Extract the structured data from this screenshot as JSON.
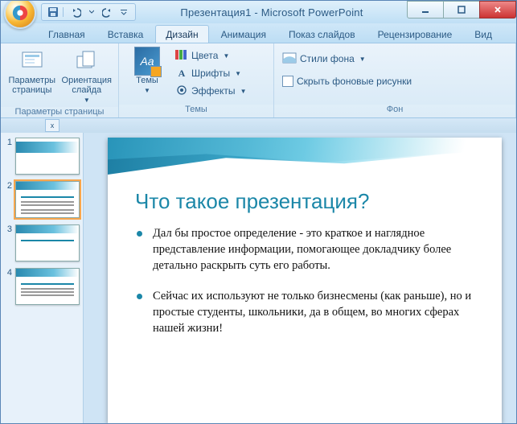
{
  "window": {
    "title": "Презентация1 - Microsoft PowerPoint"
  },
  "tabs": {
    "home": "Главная",
    "insert": "Вставка",
    "design": "Дизайн",
    "animations": "Анимация",
    "slideshow": "Показ слайдов",
    "review": "Рецензирование",
    "view": "Вид"
  },
  "ribbon": {
    "page_setup_group": "Параметры страницы",
    "page_setup_btn": "Параметры страницы",
    "orientation_btn": "Ориентация слайда",
    "themes_group": "Темы",
    "themes_btn": "Темы",
    "themes_glyph": "Aa",
    "colors": "Цвета",
    "fonts": "Шрифты",
    "effects": "Эффекты",
    "background_group": "Фон",
    "bg_styles": "Стили фона",
    "hide_bg": "Скрыть фоновые рисунки"
  },
  "thumbs": {
    "n1": "1",
    "n2": "2",
    "n3": "3",
    "n4": "4"
  },
  "slide": {
    "title": "Что такое презентация?",
    "bullet1": "Дал бы простое определение - это краткое и наглядное представление информации, помогающее докладчику более детально раскрыть суть его работы.",
    "bullet2": "Сейчас их используют не только бизнесмены (как раньше), но и простые студенты, школьники, да в общем, во многих сферах нашей жизни!"
  },
  "docstrip": {
    "close_glyph": "x"
  }
}
